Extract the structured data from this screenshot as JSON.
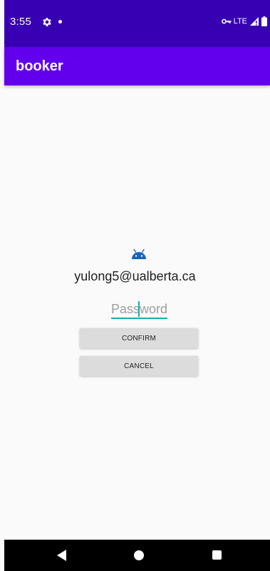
{
  "status_bar": {
    "time": "3:55",
    "network": "LTE",
    "icons": [
      "gear-icon",
      "notification-dot-icon",
      "vpn-key-icon",
      "signal-icon",
      "battery-icon"
    ]
  },
  "app_bar": {
    "title": "booker"
  },
  "login": {
    "email": "yulong5@ualberta.ca",
    "password": {
      "value": "",
      "placeholder": "Password"
    },
    "confirm_label": "CONFIRM",
    "cancel_label": "CANCEL"
  },
  "nav_bar": {
    "icons": [
      "back-icon",
      "home-icon",
      "recents-icon"
    ]
  },
  "colors": {
    "status_bar": "#3700b3",
    "app_bar": "#6200ee",
    "accent": "#11b3a9",
    "background": "#fafafa",
    "button": "#dcdcdc",
    "android_icon": "#1565c0"
  }
}
